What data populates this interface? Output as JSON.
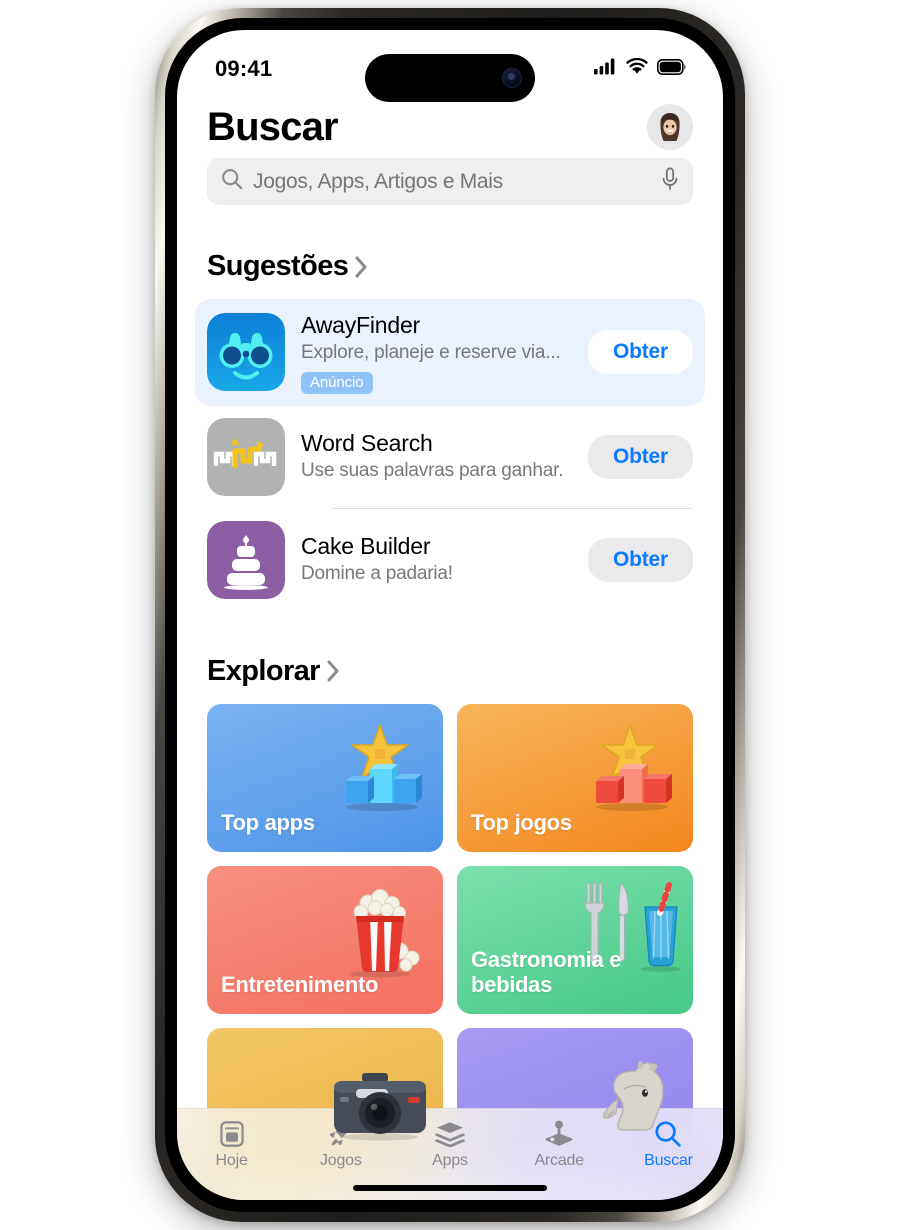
{
  "status_bar": {
    "time": "09:41",
    "cellular_icon": "signal-bars-icon",
    "wifi_icon": "wifi-icon",
    "battery_icon": "battery-icon"
  },
  "header": {
    "title": "Buscar",
    "avatar_icon": "memoji-avatar"
  },
  "search": {
    "placeholder": "Jogos, Apps, Artigos e Mais",
    "value": "",
    "search_icon": "search-icon",
    "mic_icon": "microphone-icon"
  },
  "suggestions": {
    "title": "Sugestões",
    "chevron_icon": "chevron-right-icon",
    "items": [
      {
        "name": "AwayFinder",
        "description": "Explore, planeje e reserve via...",
        "badge": "Anúncio",
        "button": "Obter",
        "icon": "binoculars-app-icon",
        "promoted": true
      },
      {
        "name": "Word Search",
        "description": "Use suas palavras para ganhar.",
        "badge": "",
        "button": "Obter",
        "icon": "word-search-app-icon",
        "promoted": false
      },
      {
        "name": "Cake Builder",
        "description": "Domine a padaria!",
        "badge": "",
        "button": "Obter",
        "icon": "cake-app-icon",
        "promoted": false
      }
    ]
  },
  "explore": {
    "title": "Explorar",
    "chevron_icon": "chevron-right-icon",
    "cards": [
      {
        "label": "Top apps",
        "color": "#6aa9ef",
        "color2": "#4b93e8",
        "art": "🏆",
        "art_icon": "podium-star-blue-icon"
      },
      {
        "label": "Top jogos",
        "color": "#f6a13c",
        "color2": "#f4871f",
        "art": "🏆",
        "art_icon": "podium-star-orange-icon"
      },
      {
        "label": "Entretenimento",
        "color": "#f67e6e",
        "color2": "#f4705f",
        "art": "🍿",
        "art_icon": "popcorn-icon"
      },
      {
        "label": "Gastronomia e bebidas",
        "color": "#63d39b",
        "color2": "#4ecb8f",
        "art": "🍽",
        "art_icon": "utensils-drink-icon"
      },
      {
        "label": "",
        "color": "#eeb94f",
        "color2": "#ecb143",
        "art": "📷",
        "art_icon": "camera-icon"
      },
      {
        "label": "",
        "color": "#9b8cf0",
        "color2": "#9083ee",
        "art": "🐴",
        "art_icon": "horse-icon"
      }
    ]
  },
  "tab_bar": {
    "tabs": [
      {
        "label": "Hoje",
        "icon": "today-article-icon",
        "active": false
      },
      {
        "label": "Jogos",
        "icon": "rocket-icon",
        "active": false
      },
      {
        "label": "Apps",
        "icon": "stacked-layers-icon",
        "active": false
      },
      {
        "label": "Arcade",
        "icon": "joystick-icon",
        "active": false
      },
      {
        "label": "Buscar",
        "icon": "search-icon",
        "active": true
      }
    ]
  },
  "colors": {
    "accent_blue": "#0a7bff",
    "promoted_card_bg": "#eaf2fd",
    "ad_badge_bg": "#8fc3f7",
    "search_bg": "#efeff0",
    "get_button_bg": "#eaeaec",
    "secondary_text": "#77777c"
  }
}
